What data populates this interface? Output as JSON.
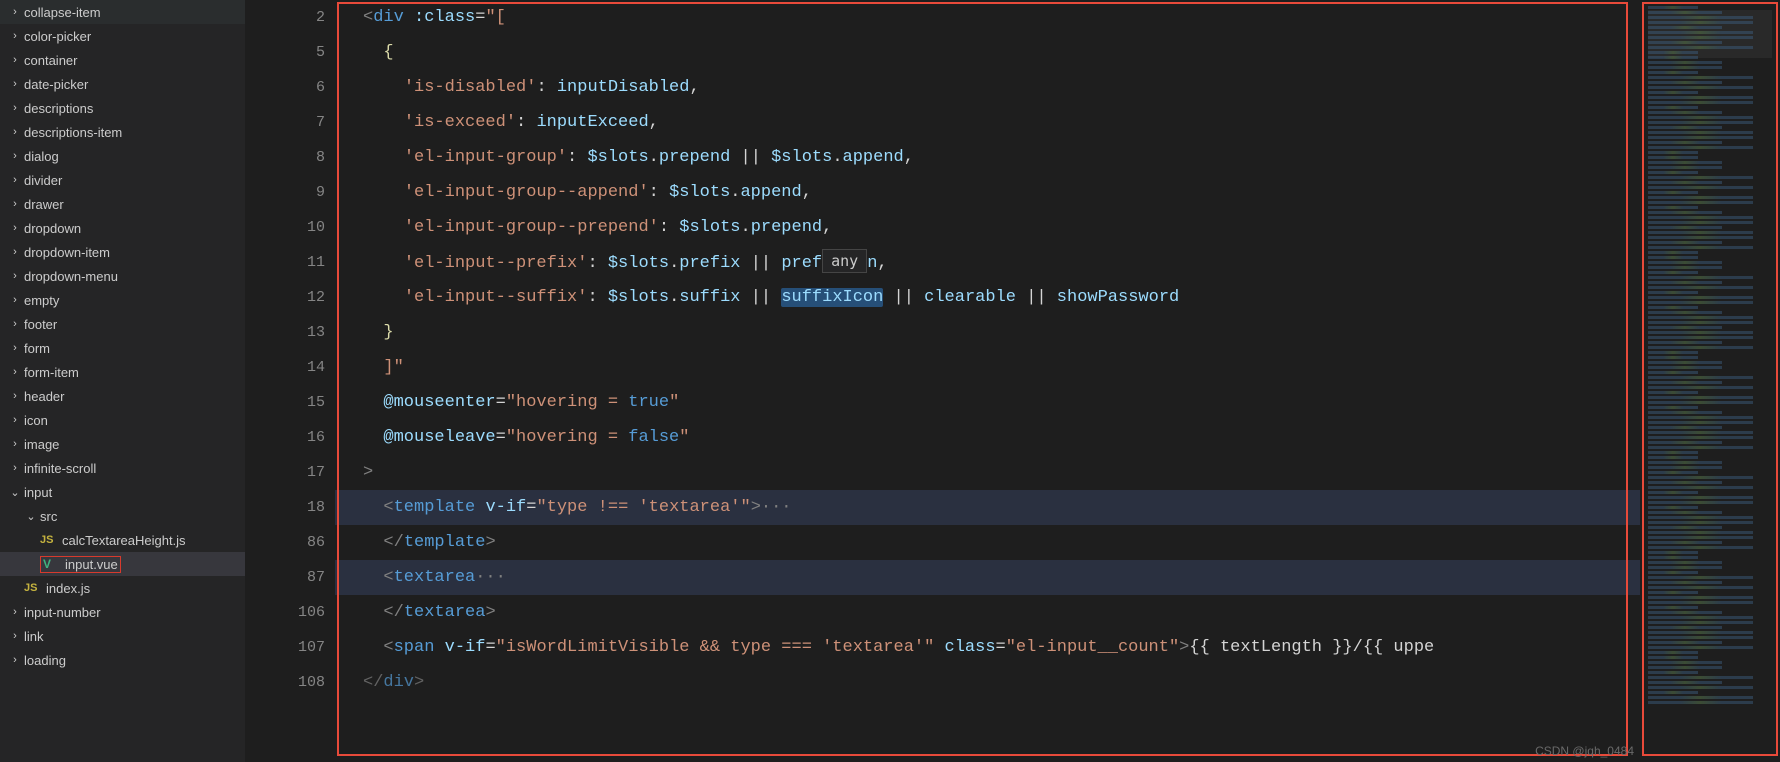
{
  "sidebar": {
    "items": [
      {
        "label": "collapse-item",
        "chev": "›",
        "indent": 0
      },
      {
        "label": "color-picker",
        "chev": "›",
        "indent": 0
      },
      {
        "label": "container",
        "chev": "›",
        "indent": 0
      },
      {
        "label": "date-picker",
        "chev": "›",
        "indent": 0
      },
      {
        "label": "descriptions",
        "chev": "›",
        "indent": 0
      },
      {
        "label": "descriptions-item",
        "chev": "›",
        "indent": 0
      },
      {
        "label": "dialog",
        "chev": "›",
        "indent": 0
      },
      {
        "label": "divider",
        "chev": "›",
        "indent": 0
      },
      {
        "label": "drawer",
        "chev": "›",
        "indent": 0
      },
      {
        "label": "dropdown",
        "chev": "›",
        "indent": 0
      },
      {
        "label": "dropdown-item",
        "chev": "›",
        "indent": 0
      },
      {
        "label": "dropdown-menu",
        "chev": "›",
        "indent": 0
      },
      {
        "label": "empty",
        "chev": "›",
        "indent": 0
      },
      {
        "label": "footer",
        "chev": "›",
        "indent": 0
      },
      {
        "label": "form",
        "chev": "›",
        "indent": 0
      },
      {
        "label": "form-item",
        "chev": "›",
        "indent": 0
      },
      {
        "label": "header",
        "chev": "›",
        "indent": 0
      },
      {
        "label": "icon",
        "chev": "›",
        "indent": 0
      },
      {
        "label": "image",
        "chev": "›",
        "indent": 0
      },
      {
        "label": "infinite-scroll",
        "chev": "›",
        "indent": 0
      },
      {
        "label": "input",
        "chev": "⌄",
        "indent": 0
      },
      {
        "label": "src",
        "chev": "⌄",
        "indent": 1
      },
      {
        "label": "calcTextareaHeight.js",
        "icon": "JS",
        "iconClass": "js",
        "indent": 2
      },
      {
        "label": "input.vue",
        "icon": "V",
        "iconClass": "vue",
        "indent": 2,
        "active": true
      },
      {
        "label": "index.js",
        "icon": "JS",
        "iconClass": "js",
        "indent": 1
      },
      {
        "label": "input-number",
        "chev": "›",
        "indent": 0
      },
      {
        "label": "link",
        "chev": "›",
        "indent": 0
      },
      {
        "label": "loading",
        "chev": "›",
        "indent": 0
      }
    ]
  },
  "lines": [
    {
      "num": "2"
    },
    {
      "num": "5"
    },
    {
      "num": "6"
    },
    {
      "num": "7"
    },
    {
      "num": "8"
    },
    {
      "num": "9"
    },
    {
      "num": "10"
    },
    {
      "num": "11"
    },
    {
      "num": "12"
    },
    {
      "num": "13"
    },
    {
      "num": "14"
    },
    {
      "num": "15"
    },
    {
      "num": "16"
    },
    {
      "num": "17"
    },
    {
      "num": "18",
      "fold": true
    },
    {
      "num": "86"
    },
    {
      "num": "87",
      "fold": true
    },
    {
      "num": "106"
    },
    {
      "num": "107"
    },
    {
      "num": "108"
    }
  ],
  "hint": "any",
  "code": {
    "l2_tag": "div",
    "l2_attr": ":class",
    "l2_str": "\"[",
    "l5": "{",
    "l6_key": "'is-disabled'",
    "l6_val": "inputDisabled",
    "l7_key": "'is-exceed'",
    "l7_val": "inputExceed",
    "l8_key": "'el-input-group'",
    "l8_p1": "$slots",
    "l8_p2": "prepend",
    "l8_p3": "$slots",
    "l8_p4": "append",
    "l9_key": "'el-input-group--append'",
    "l9_p1": "$slots",
    "l9_p2": "append",
    "l10_key": "'el-input-group--prepend'",
    "l10_p1": "$slots",
    "l10_p2": "prepend",
    "l11_key": "'el-input--prefix'",
    "l11_p1": "$slots",
    "l11_p2": "prefix",
    "l11_p3": "pref",
    "l11_p4": "n",
    "l12_key": "'el-input--suffix'",
    "l12_p1": "$slots",
    "l12_p2": "suffix",
    "l12_p3": "suffixIcon",
    "l12_p4": "clearable",
    "l12_p5": "showPassword",
    "l13": "}",
    "l14": "]\"",
    "l15_attr": "@mouseenter",
    "l15_str1": "\"hovering = ",
    "l15_val": "true",
    "l15_str2": "\"",
    "l16_attr": "@mouseleave",
    "l16_str1": "\"hovering = ",
    "l16_val": "false",
    "l16_str2": "\"",
    "l17": ">",
    "l18_tag": "template",
    "l18_attr": "v-if",
    "l18_str": "\"type !== 'textarea'\"",
    "l18_dots": "···",
    "l86_tag": "template",
    "l87_tag": "textarea",
    "l87_dots": "···",
    "l106_tag": "textarea",
    "l107_tag": "span",
    "l107_attr1": "v-if",
    "l107_str1": "\"isWordLimitVisible && type === 'textarea'\"",
    "l107_attr2": "class",
    "l107_str2": "\"el-input__count\"",
    "l107_txt1": "{{ textLength }}",
    "l107_txt2": "/",
    "l107_txt3": "{{ uppe",
    "l108_tag": "div"
  },
  "watermark": "CSDN @jqh_0484"
}
